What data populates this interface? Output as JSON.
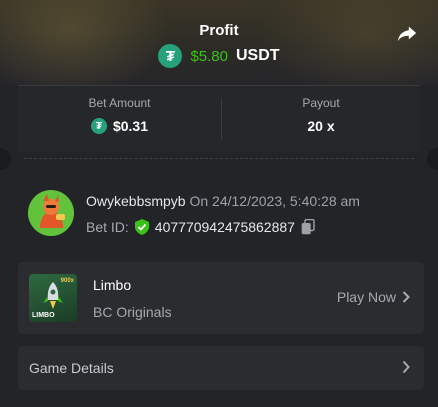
{
  "header": {
    "title": "Profit",
    "profit_value": "$5.80",
    "currency": "USDT"
  },
  "stats": {
    "bet_amount_label": "Bet Amount",
    "bet_amount_value": "$0.31",
    "payout_label": "Payout",
    "payout_value": "20 x"
  },
  "user": {
    "name": "Owykebbsmpyb",
    "on_text": "On 24/12/2023, 5:40:28 am",
    "bet_id_label": "Bet ID:",
    "bet_id": "407770942475862887"
  },
  "game": {
    "name": "Limbo",
    "provider": "BC Originals",
    "play_label": "Play Now",
    "thumb_text": "LIMBO",
    "thumb_badge": "900x"
  },
  "details": {
    "label": "Game Details"
  },
  "colors": {
    "accent_green": "#3bc117",
    "tether": "#26a17b"
  }
}
